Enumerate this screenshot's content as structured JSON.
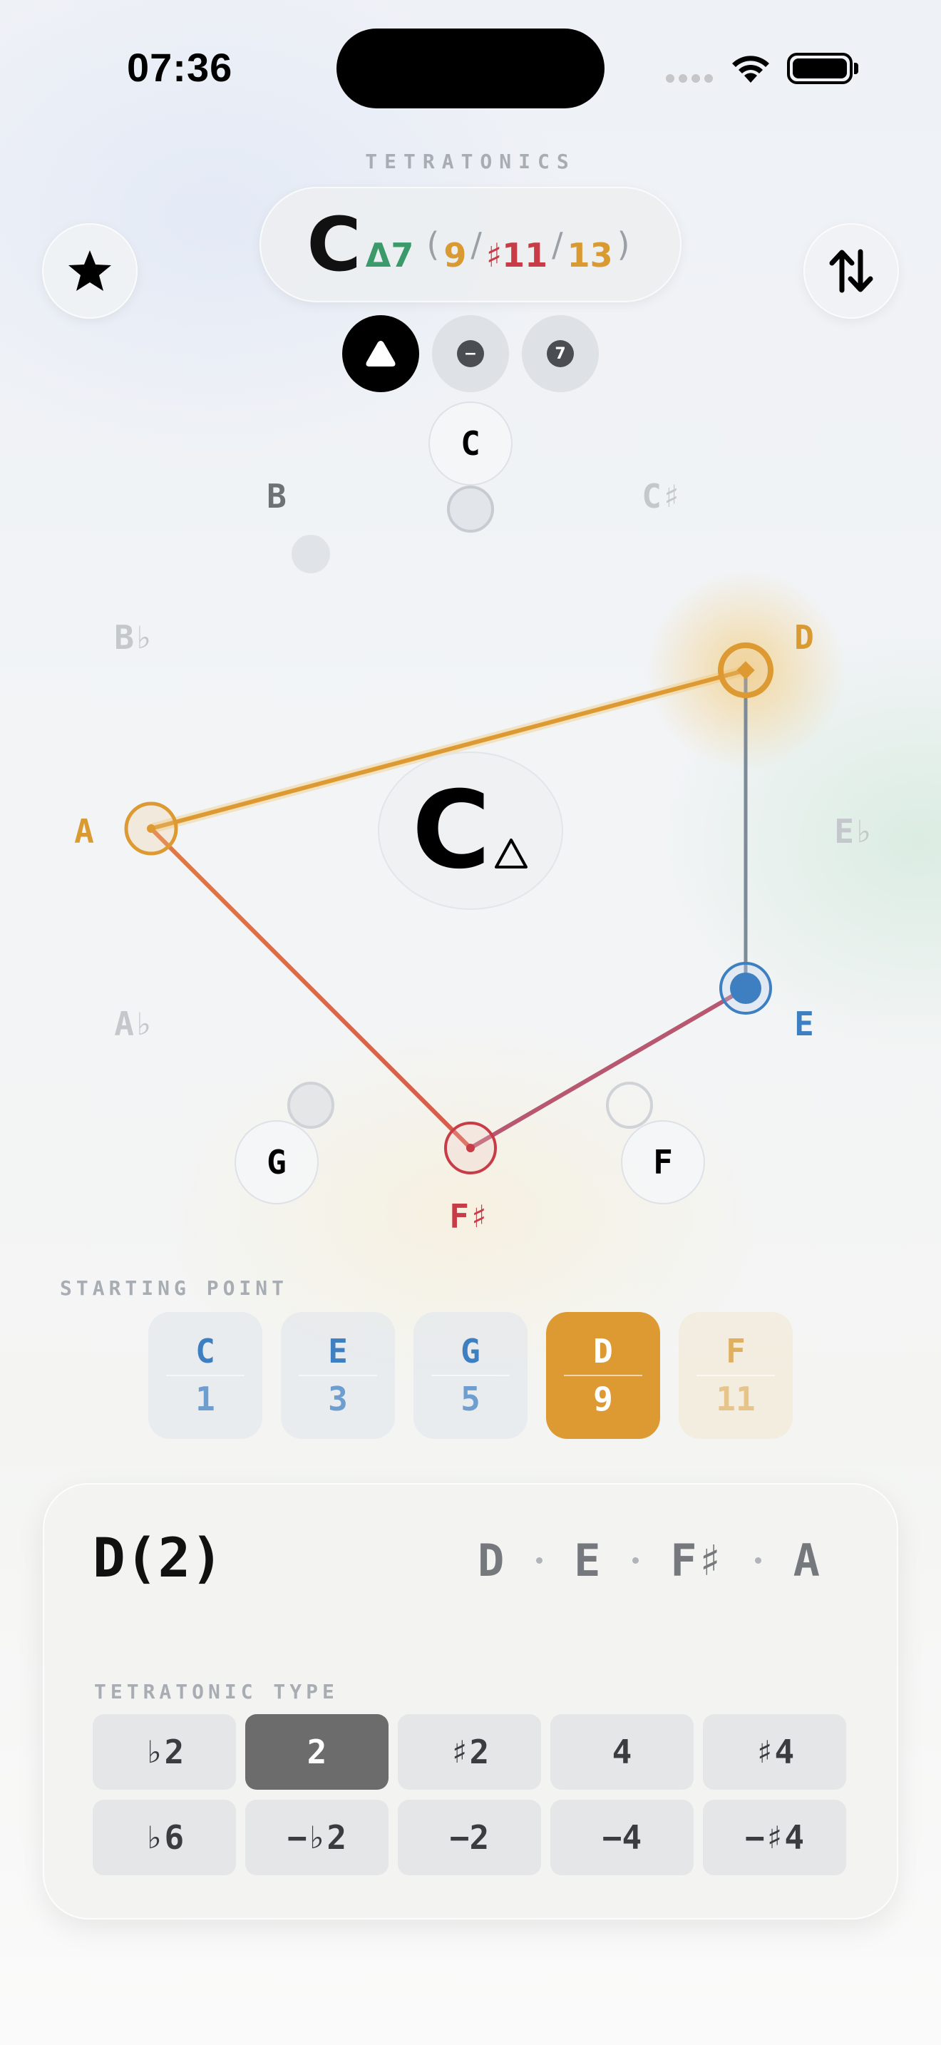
{
  "status_bar": {
    "time": "07:36"
  },
  "app": {
    "title": "TETRATONICS"
  },
  "chord": {
    "root": "C",
    "quality": "Δ7",
    "open_paren": "(",
    "ext1": "9",
    "sep1": "/",
    "ext2": "♯11",
    "sep2": "/",
    "ext3": "13",
    "close_paren": ")"
  },
  "mode_buttons": [
    {
      "icon": "triangle-icon",
      "selected": true
    },
    {
      "icon": "minus-icon",
      "label": "−",
      "selected": false
    },
    {
      "icon": "seven-icon",
      "label": "7",
      "selected": false
    }
  ],
  "circle": {
    "center_root": "C",
    "center_quality_icon": "triangle-outline-icon",
    "notes": {
      "C": "C",
      "Db": "C♯",
      "D": "D",
      "Eb": "E♭",
      "E": "E",
      "F": "F",
      "Fs": "F♯",
      "G": "G",
      "Ab": "A♭",
      "A": "A",
      "Bb": "B♭",
      "B": "B"
    }
  },
  "starting_point": {
    "label": "STARTING POINT",
    "options": [
      {
        "note": "C",
        "degree": "1",
        "state": "normal"
      },
      {
        "note": "E",
        "degree": "3",
        "state": "normal"
      },
      {
        "note": "G",
        "degree": "5",
        "state": "normal"
      },
      {
        "note": "D",
        "degree": "9",
        "state": "selected"
      },
      {
        "note": "F",
        "degree": "11",
        "state": "faded"
      }
    ]
  },
  "scale": {
    "name": "D(2)",
    "notes": [
      "D",
      "E",
      "F♯",
      "A"
    ]
  },
  "tetratonic_type": {
    "label": "TETRATONIC TYPE",
    "options": [
      "♭2",
      "2",
      "♯2",
      "4",
      "♯4",
      "♭6",
      "−♭2",
      "−2",
      "−4",
      "−♯4"
    ],
    "selected": "2"
  },
  "colors": {
    "accent_orange": "#dd9a33",
    "accent_blue": "#3d7fc0",
    "accent_red": "#c83c48",
    "accent_green": "#3a9a6a"
  }
}
